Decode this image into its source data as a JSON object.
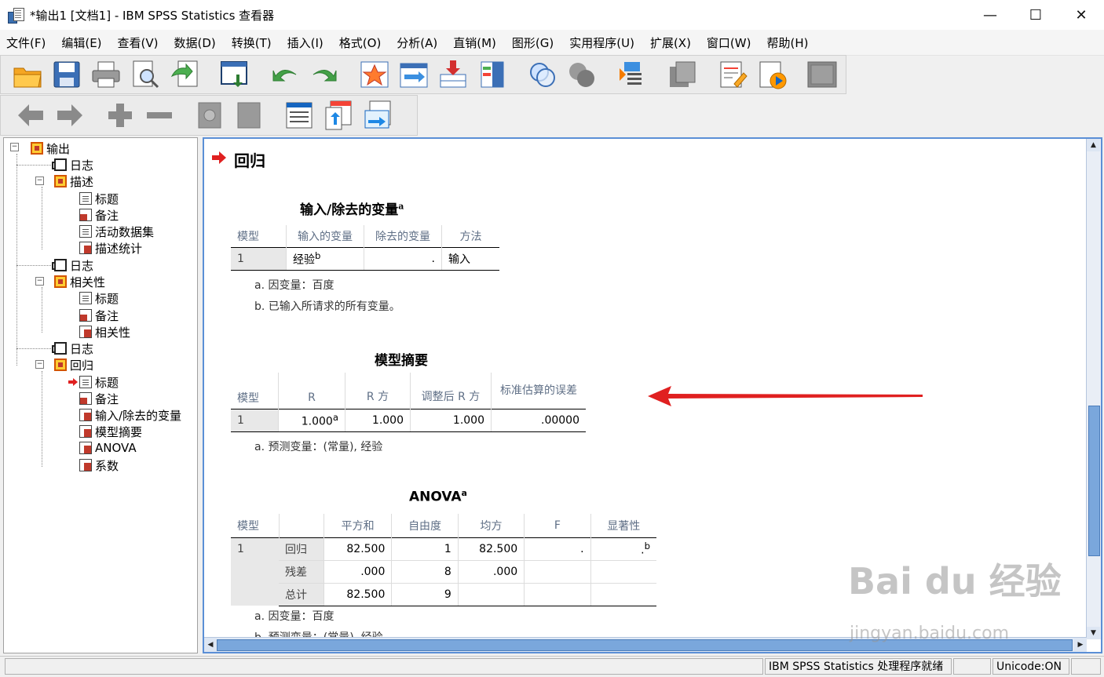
{
  "window": {
    "title": "*输出1 [文档1] - IBM SPSS Statistics 查看器",
    "minimize": "—",
    "maximize": "☐",
    "close": "✕"
  },
  "menu": [
    "文件(F)",
    "编辑(E)",
    "查看(V)",
    "数据(D)",
    "转换(T)",
    "插入(I)",
    "格式(O)",
    "分析(A)",
    "直销(M)",
    "图形(G)",
    "实用程序(U)",
    "扩展(X)",
    "窗口(W)",
    "帮助(H)"
  ],
  "toolbar1": [
    "open-icon",
    "save-icon",
    "print-icon",
    "print-preview-icon",
    "export-icon",
    "goto-data-icon",
    "undo-icon",
    "redo-icon",
    "goto-case-icon",
    "goto-variable-icon",
    "insert-cases-icon",
    "insert-variable-icon",
    "select-cases-icon",
    "weight-cases-icon",
    "value-labels-icon",
    "use-sets-icon",
    "script-icon",
    "run-script-icon",
    "designate-window-icon"
  ],
  "toolbar2": [
    "back-icon",
    "forward-icon",
    "expand-icon",
    "collapse-icon",
    "show-icon",
    "hide-icon",
    "insert-heading-icon",
    "insert-title-icon",
    "insert-text-icon"
  ],
  "outline": [
    {
      "label": "输出",
      "icon": "folder"
    },
    {
      "label": "日志",
      "icon": "book"
    },
    {
      "label": "描述",
      "icon": "folder"
    },
    {
      "label": "标题",
      "icon": "doc"
    },
    {
      "label": "备注",
      "icon": "note"
    },
    {
      "label": "活动数据集",
      "icon": "doc"
    },
    {
      "label": "描述统计",
      "icon": "table"
    },
    {
      "label": "日志",
      "icon": "book"
    },
    {
      "label": "相关性",
      "icon": "folder"
    },
    {
      "label": "标题",
      "icon": "doc"
    },
    {
      "label": "备注",
      "icon": "note"
    },
    {
      "label": "相关性",
      "icon": "table"
    },
    {
      "label": "日志",
      "icon": "book"
    },
    {
      "label": "回归",
      "icon": "folder"
    },
    {
      "label": "标题",
      "icon": "doc"
    },
    {
      "label": "备注",
      "icon": "note"
    },
    {
      "label": "输入/除去的变量",
      "icon": "table"
    },
    {
      "label": "模型摘要",
      "icon": "table"
    },
    {
      "label": "ANOVA",
      "icon": "table"
    },
    {
      "label": "系数",
      "icon": "table"
    }
  ],
  "content": {
    "heading": "回归",
    "table1": {
      "title": "输入/除去的变量",
      "title_sup": "a",
      "headers": [
        "模型",
        "输入的变量",
        "除去的变量",
        "方法"
      ],
      "row": [
        "1",
        "经验",
        ".",
        "输入"
      ],
      "entered_sup": "b",
      "footnotes": [
        "a. 因变量：百度",
        "b. 已输入所请求的所有变量。"
      ]
    },
    "table2": {
      "title": "模型摘要",
      "headers": [
        "模型",
        "R",
        "R 方",
        "调整后 R 方",
        "标准估算的误差"
      ],
      "row": [
        "1",
        "1.000",
        "1.000",
        "1.000",
        ".00000"
      ],
      "r_sup": "a",
      "footnotes": [
        "a. 预测变量：(常量), 经验"
      ]
    },
    "table3": {
      "title": "ANOVA",
      "title_sup": "a",
      "headers": [
        "模型",
        "",
        "平方和",
        "自由度",
        "均方",
        "F",
        "显著性"
      ],
      "model": "1",
      "rows": [
        {
          "label": "回归",
          "ss": "82.500",
          "df": "1",
          "ms": "82.500",
          "f": ".",
          "sig": "."
        },
        {
          "label": "残差",
          "ss": ".000",
          "df": "8",
          "ms": ".000",
          "f": "",
          "sig": ""
        },
        {
          "label": "总计",
          "ss": "82.500",
          "df": "9",
          "ms": "",
          "f": "",
          "sig": ""
        }
      ],
      "sig_sup": "b",
      "footnotes": [
        "a. 因变量：百度",
        "b. 预测变量：(常量), 经验"
      ]
    }
  },
  "status": {
    "processor": "IBM SPSS Statistics 处理程序就绪",
    "unicode": "Unicode:ON"
  },
  "watermark": {
    "brand": "Bai du 经验",
    "url": "jingyan.baidu.com"
  },
  "colors": {
    "accent_arrow": "#e02020",
    "pane_border": "#5b8fd6"
  }
}
